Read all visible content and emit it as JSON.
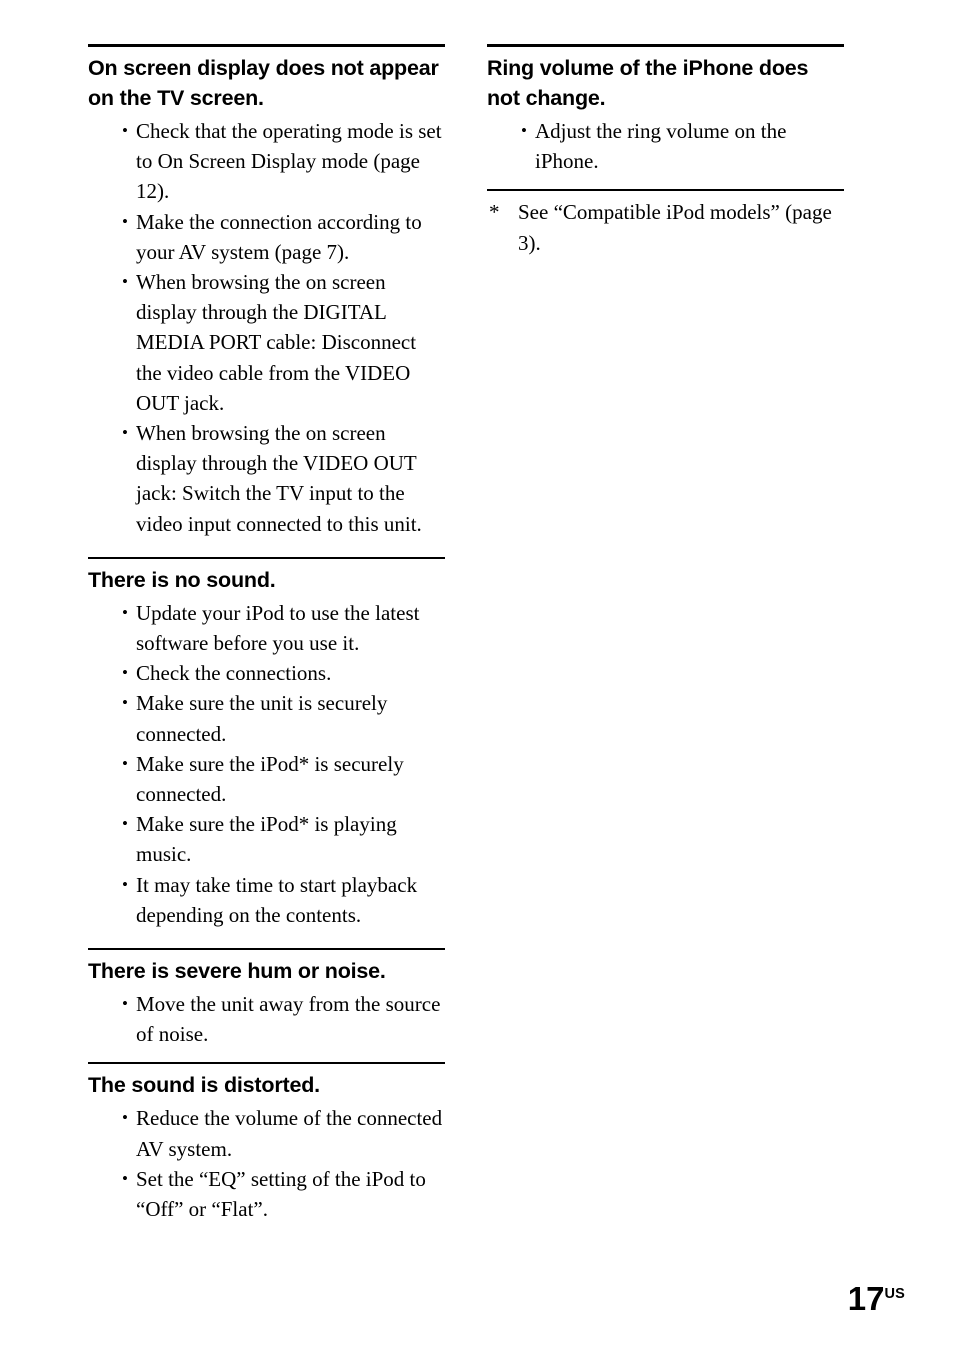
{
  "page": {
    "number": "17",
    "number_suffix": "US"
  },
  "left_column": {
    "sections": [
      {
        "heading": "On screen display does not appear on the TV screen.",
        "bullets": [
          "Check that the operating mode is set to On Screen Display mode (page 12).",
          "Make the connection according to your AV system (page 7).",
          "When browsing the on screen display through the DIGITAL MEDIA PORT cable: Disconnect the video cable from the VIDEO OUT jack.",
          "When browsing the on screen display through the VIDEO OUT jack: Switch the TV input to the video input connected to this unit."
        ]
      },
      {
        "heading": "There is no sound.",
        "bullets": [
          "Update your iPod to use the latest software before you use it.",
          "Check the connections.",
          "Make sure the unit is securely connected.",
          "Make sure the iPod* is securely connected.",
          "Make sure the iPod* is playing music.",
          "It may take time to start playback depending on the contents."
        ]
      },
      {
        "heading": "There is severe hum or noise.",
        "bullets": [
          "Move the unit away from the source of noise."
        ]
      },
      {
        "heading": "The sound is distorted.",
        "bullets": [
          "Reduce the volume of the connected AV system.",
          "Set the “EQ” setting of the iPod to “Off” or “Flat”."
        ]
      }
    ]
  },
  "right_column": {
    "sections": [
      {
        "heading": "Ring volume of the iPhone does not change.",
        "bullets": [
          "Adjust the ring volume on the iPhone."
        ]
      }
    ],
    "footnote": {
      "marker": "*",
      "text": "See “Compatible iPod models” (page 3)."
    }
  }
}
